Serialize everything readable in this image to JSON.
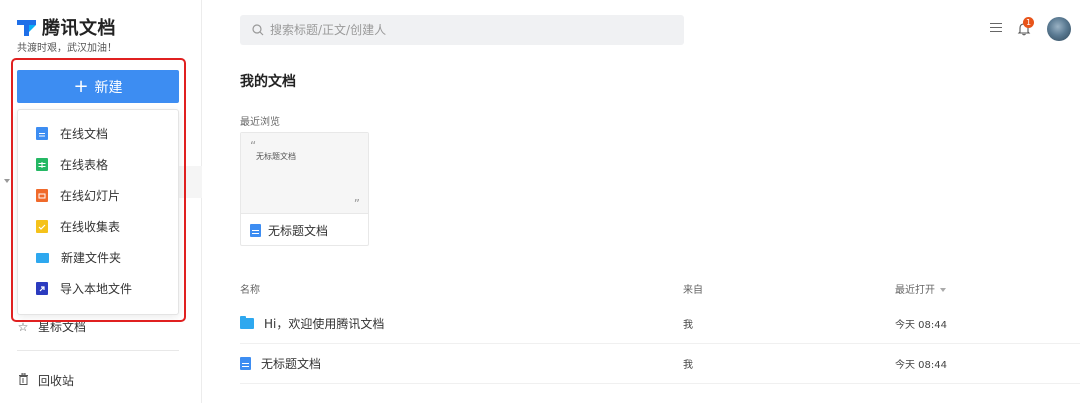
{
  "app": {
    "title": "腾讯文档",
    "subtitle": "共渡时艰，武汉加油！"
  },
  "sidebar": {
    "new_button_label": "新建",
    "new_menu": [
      {
        "label": "在线文档",
        "icon": "doc-icon",
        "color": "#3d8df2"
      },
      {
        "label": "在线表格",
        "icon": "sheet-icon",
        "color": "#25b864"
      },
      {
        "label": "在线幻灯片",
        "icon": "slide-icon",
        "color": "#f06a2b"
      },
      {
        "label": "在线收集表",
        "icon": "form-icon",
        "color": "#f5c21a"
      },
      {
        "label": "新建文件夹",
        "icon": "folder-icon",
        "color": "#2ea8ef"
      },
      {
        "label": "导入本地文件",
        "icon": "import-icon",
        "color": "#2b3bbf"
      }
    ],
    "starred_label": "星标文档",
    "trash_label": "回收站"
  },
  "search": {
    "placeholder": "搜索标题/正文/创建人"
  },
  "header": {
    "notification_count": "1"
  },
  "main": {
    "title": "我的文档",
    "recent_label": "最近浏览",
    "recent_cards": [
      {
        "preview_text": "无标题文档",
        "name": "无标题文档",
        "icon": "doc-icon"
      }
    ],
    "columns": {
      "name": "名称",
      "from": "来自",
      "last_opened": "最近打开"
    },
    "rows": [
      {
        "icon": "folder-icon",
        "name": "Hi，欢迎使用腾讯文档",
        "from": "我",
        "time": "今天 08:44"
      },
      {
        "icon": "doc-icon",
        "name": "无标题文档",
        "from": "我",
        "time": "今天 08:44"
      }
    ]
  },
  "colors": {
    "accent": "#3d8df2",
    "highlight_border": "#e02020",
    "badge": "#e8541a"
  }
}
